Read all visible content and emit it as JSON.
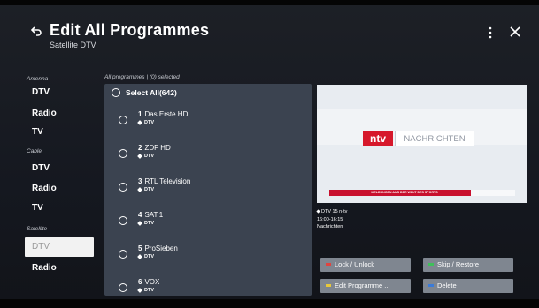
{
  "header": {
    "title": "Edit All Programmes",
    "subtitle": "Satellite DTV"
  },
  "sidebar": {
    "groups": [
      {
        "label": "Antenna",
        "items": [
          "DTV",
          "Radio",
          "TV"
        ]
      },
      {
        "label": "Cable",
        "items": [
          "DTV",
          "Radio",
          "TV"
        ]
      },
      {
        "label": "Satellite",
        "items": [
          "DTV",
          "Radio"
        ]
      }
    ],
    "selected": "Satellite DTV"
  },
  "list": {
    "header": "All programmes | (0) selected",
    "select_all": "Select All(642)",
    "rows": [
      {
        "num": "1",
        "name": "Das Erste HD",
        "band": "DTV"
      },
      {
        "num": "2",
        "name": "ZDF HD",
        "band": "DTV"
      },
      {
        "num": "3",
        "name": "RTL Television",
        "band": "DTV"
      },
      {
        "num": "4",
        "name": "SAT.1",
        "band": "DTV"
      },
      {
        "num": "5",
        "name": "ProSieben",
        "band": "DTV"
      },
      {
        "num": "6",
        "name": "VOX",
        "band": "DTV"
      }
    ]
  },
  "preview": {
    "logo": "ntv",
    "logo_caption": "NACHRICHTEN",
    "ticker": "MELDUNGEN AUS DER WELT DES SPORTS"
  },
  "info": {
    "channel": "DTV 15  n-tv",
    "time": "16:00-16:15",
    "programme": "Nachrichten"
  },
  "buttons": {
    "lock": "Lock / Unlock",
    "skip": "Skip / Restore",
    "edit": "Edit Programme ...",
    "delete": "Delete"
  },
  "colors": {
    "panel": "#3b4350",
    "button": "#7f8690",
    "key_red": "#e0443f",
    "key_green": "#3fbf5a",
    "key_yellow": "#e8c83a",
    "key_blue": "#3b7bd8",
    "brand_red": "#d6182b"
  }
}
